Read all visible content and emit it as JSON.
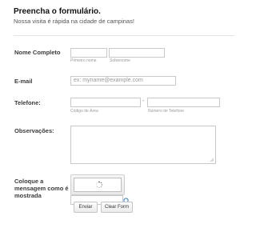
{
  "header": {
    "title": "Preencha o formulário.",
    "subtitle": "Nossa visita é rápida na cidade de campinas!"
  },
  "fields": {
    "name": {
      "label": "Nome Completo",
      "first_sublabel": "Primeiro nome",
      "last_sublabel": "Sobrenome"
    },
    "email": {
      "label": "E-mail",
      "placeholder": "ex: myname@example.com"
    },
    "phone": {
      "label": "Telefone:",
      "separator": "-",
      "area_sublabel": "Código de Área",
      "number_sublabel": "Número de Telefone"
    },
    "notes": {
      "label": "Observações:"
    },
    "captcha": {
      "label": "Coloque a mensagem como é mostrada"
    }
  },
  "buttons": {
    "submit": "Enviar",
    "clear": "Clear Form"
  },
  "colors": {
    "accent_icon": "#3a8ad8",
    "border": "#c9c9c9"
  }
}
